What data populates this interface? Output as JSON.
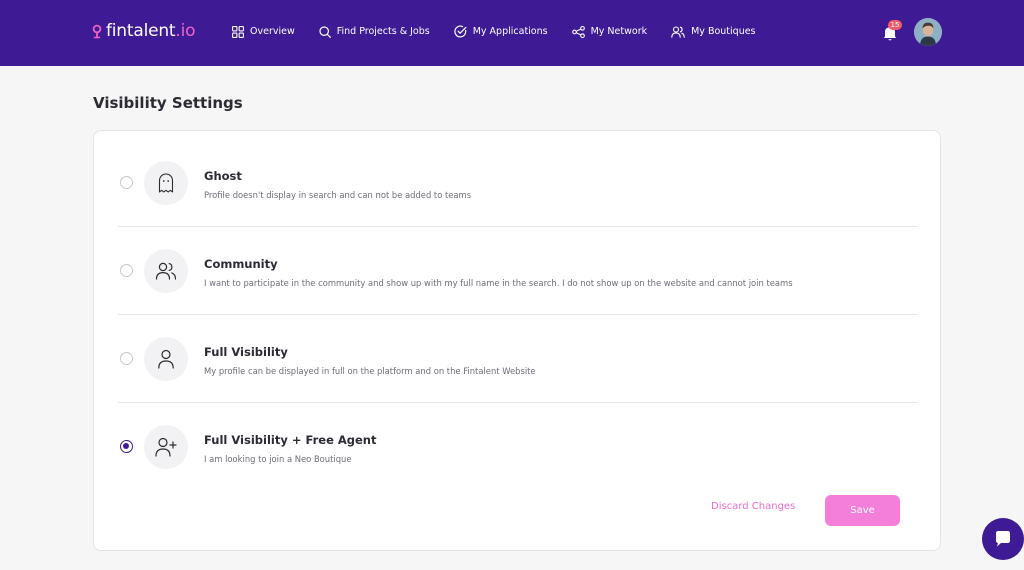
{
  "header": {
    "brand": {
      "name": "fintalent",
      "tld": ".io"
    },
    "nav": [
      {
        "label": "Overview",
        "icon": "grid-icon"
      },
      {
        "label": "Find Projects & Jobs",
        "icon": "search-icon"
      },
      {
        "label": "My Applications",
        "icon": "check-circle-icon"
      },
      {
        "label": "My Network",
        "icon": "share-icon"
      },
      {
        "label": "My Boutiques",
        "icon": "users-icon"
      }
    ],
    "notifications": {
      "count": "15",
      "icon": "bell-icon"
    }
  },
  "page": {
    "title": "Visibility Settings"
  },
  "options": [
    {
      "title": "Ghost",
      "description": "Profile doesn't display in search and can not be added to teams",
      "icon": "ghost-icon",
      "selected": false
    },
    {
      "title": "Community",
      "description": "I want to participate in the community and show up with my full name in the search. I do not show up on the website and cannot join teams",
      "icon": "users-icon",
      "selected": false
    },
    {
      "title": "Full Visibility",
      "description": "My profile can be displayed in full on the platform and on the Fintalent Website",
      "icon": "user-icon",
      "selected": false
    },
    {
      "title": "Full Visibility + Free Agent",
      "description": "I am looking to join a Neo Boutique",
      "icon": "user-plus-icon",
      "selected": true
    }
  ],
  "actions": {
    "discard_label": "Discard Changes",
    "save_label": "Save"
  },
  "colors": {
    "header_bg": "#3e1a94",
    "accent_pink": "#f063c6",
    "save_bg": "#f47fdb",
    "badge": "#f25a67"
  }
}
